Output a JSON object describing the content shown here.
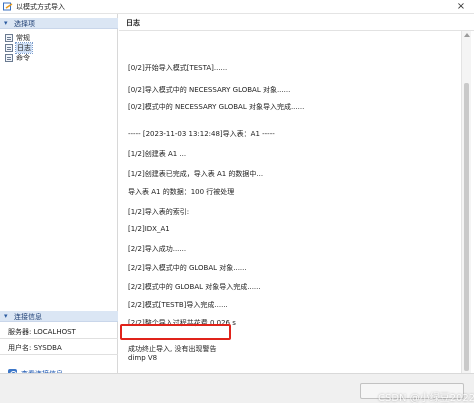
{
  "window": {
    "title": "以模式方式导入",
    "close_glyph": "×"
  },
  "left_panel": {
    "options_header": "选择项",
    "options": [
      {
        "label": "常规",
        "selected": false
      },
      {
        "label": "日志",
        "selected": true
      },
      {
        "label": "命令",
        "selected": false
      }
    ],
    "connection_header": "连接信息",
    "server_line": "服务器: LOCALHOST",
    "user_line": "用户名: SYSDBA",
    "view_link": "查看连接信息"
  },
  "log_panel": {
    "header": "日志",
    "lines": [
      "[0/2]开始导入模式[TESTA]......",
      "[0/2]导入模式中的 NECESSARY GLOBAL 对象......",
      "[0/2]模式中的 NECESSARY GLOBAL 对象导入完成......",
      "----- [2023-11-03 13:12:48]导入表：A1 -----",
      "[1/2]创建表 A1 ...",
      "[1/2]创建表已完成，导入表 A1 的数据中...",
      "导入表 A1 的数据：100 行被处理",
      "[1/2]导入表的索引:",
      "[1/2]IDX_A1",
      "[2/2]导入成功......",
      "[2/2]导入模式中的 GLOBAL 对象......",
      "[2/2]模式中的 GLOBAL 对象导入完成......",
      "[2/2]模式[TESTB]导入完成......",
      "[2/2]整个导入过程共花费    0.026 s",
      "成功终止导入, 没有出现警告",
      "dimp V8"
    ]
  },
  "watermark": "CSDN @小绿豆2022",
  "colors": {
    "accent": "#2a5aa0",
    "highlight": "#e0231a"
  }
}
